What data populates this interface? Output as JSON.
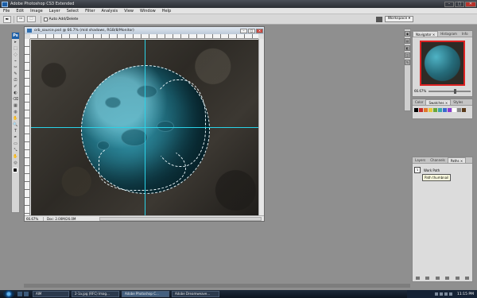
{
  "app": {
    "title": "Adobe Photoshop CS3 Extended",
    "window_controls": [
      "–",
      "□",
      "✕"
    ]
  },
  "menu": [
    "File",
    "Edit",
    "Image",
    "Layer",
    "Select",
    "Filter",
    "Analysis",
    "View",
    "Window",
    "Help"
  ],
  "options_bar": {
    "tool_icon": "pen-tool-icon",
    "auto_add_delete_label": "Auto Add/Delete",
    "workspace_label": "Workspace ▾"
  },
  "toolbox": {
    "logo": "Ps",
    "tools": [
      "▸",
      "⬚",
      "◌",
      "⌁",
      "✂",
      "✎",
      "⎚",
      "✐",
      "◐",
      "⌫",
      "▦",
      "◍",
      "✋",
      "🔍",
      "T",
      "✒",
      "▭",
      "⤡",
      "✋",
      "◎"
    ],
    "foreground_color": "#000000",
    "background_color": "#ffffff"
  },
  "document": {
    "title": "orb_source.psd @ 66.7% (mid shadows, RGB/8/Monitor)",
    "window_buttons": [
      "–",
      "□",
      "✕"
    ],
    "zoom": "66.67%",
    "doc_info": "Doc: 2.00M/26.0M"
  },
  "dock": [
    "◆",
    "▤",
    "◧",
    "◫",
    "✎"
  ],
  "navigator_panel": {
    "tabs": [
      "Navigator ×",
      "Histogram",
      "Info"
    ],
    "zoom": "66.67%"
  },
  "color_panel": {
    "tabs": [
      "Color",
      "Swatches ×",
      "Styles"
    ],
    "swatches": [
      "#000000",
      "#c62a2a",
      "#e2782a",
      "#e6c93a",
      "#6aa83a",
      "#3aa8a8",
      "#3a6ad0",
      "#8a3ad0",
      "#ffffff",
      "#888888",
      "#5a3a1a"
    ]
  },
  "layers_panel": {
    "tabs": [
      "Layers",
      "Channels",
      "Paths ×"
    ],
    "path_name": "Work Path",
    "tooltip": "Path thumbnail"
  },
  "taskbar": {
    "tasks": [
      "AIM",
      "2-1a.jpg (RFC) Imag...",
      "Adobe Photoshop C...",
      "Adobe Dreamweave..."
    ],
    "clock": "11:15 PM"
  }
}
